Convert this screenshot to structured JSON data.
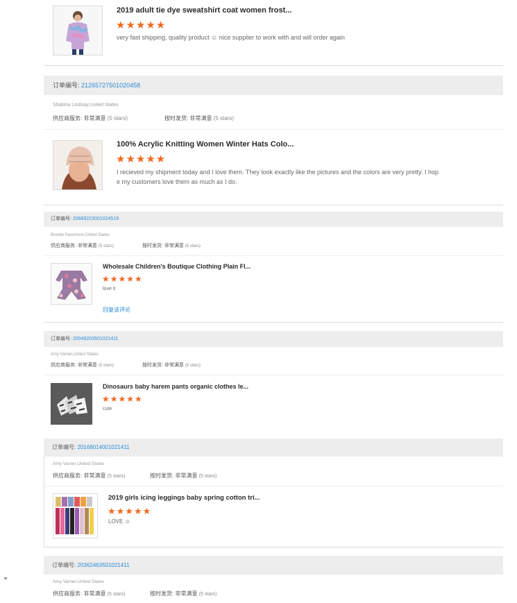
{
  "label_order_no": "订单编号:",
  "label_supplier_service": "供应商服务:",
  "label_on_time_delivery": "按时发货:",
  "star_glyph": "★★★★★",
  "reviews": [
    {
      "title": "2019 adult tie dye sweatshirt coat women frost...",
      "comment": "very fast shipping, quality product ☺ nice supplier to work with and will order again"
    },
    {
      "order_no": "21265727501020458",
      "buyer": "Shalima Lindsay,United States",
      "supplier_rating": "非常满意",
      "supplier_stars": "(5 stars)",
      "delivery_rating": "非常满意",
      "delivery_stars": "(5 stars)",
      "title": "100% Acrylic Knitting Women Winter Hats Colo...",
      "comment": "I recieved my shipment today and I love them. They look exactly like the pictures and the colors are very pretty. I hope my customers love them as much as I do."
    },
    {
      "order_no": "20669223001024519",
      "buyer": "Brooke Passmore,United States",
      "supplier_rating": "非常满意",
      "supplier_stars": "(5 stars)",
      "delivery_rating": "非常满意",
      "delivery_stars": "(5 stars)",
      "title": "Wholesale Children's Boutique Clothing Plain Fl...",
      "comment": "love it",
      "reply": "回复该评论"
    },
    {
      "order_no": "20049203501021411",
      "buyer": "Amy Varner,United States",
      "supplier_rating": "非常满意",
      "supplier_stars": "(5 stars)",
      "delivery_rating": "非常满意",
      "delivery_stars": "(5 stars)",
      "title": "Dinosaurs baby harem pants organic clothes le...",
      "comment": "cute"
    },
    {
      "order_no": "20168014001021411",
      "buyer": "Amy Varner,United States",
      "supplier_rating": "非常满意",
      "supplier_stars": "(5 stars)",
      "delivery_rating": "非常满意",
      "delivery_stars": "(5 stars)",
      "title": "2019 girls icing leggings baby spring cotton tri...",
      "comment": "LOVE ☺"
    },
    {
      "order_no": "20362463501021411",
      "buyer": "Amy Varner,United States",
      "supplier_rating": "非常满意",
      "supplier_stars": "(5 stars)",
      "delivery_rating": "非常满意",
      "delivery_stars": "(5 stars)"
    }
  ]
}
